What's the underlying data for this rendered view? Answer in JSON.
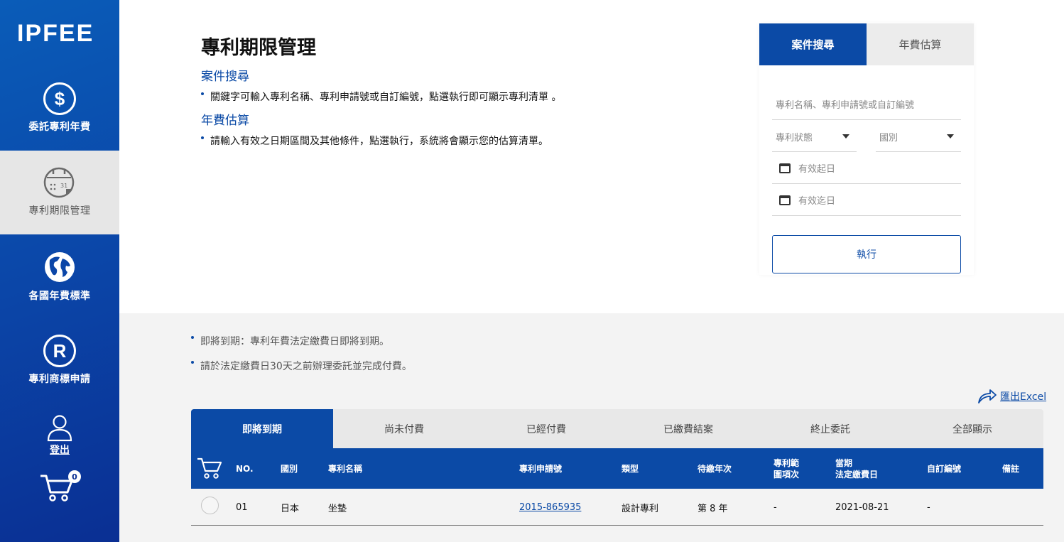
{
  "sidebar": {
    "logo": "IPFEE",
    "items": [
      {
        "label": "委託專利年費",
        "icon": "$"
      },
      {
        "label": "專利期限管理"
      },
      {
        "label": "各國年費標準"
      },
      {
        "label": "專利商標申請",
        "icon": "R"
      }
    ],
    "logout": "登出",
    "cart_count": "0"
  },
  "info": {
    "title": "專利期限管理",
    "sections": [
      {
        "heading": "案件搜尋",
        "bullet": "關鍵字可輸入專利名稱、專利申請號或自訂編號，點選執行即可顯示專利清單 。"
      },
      {
        "heading": "年費估算",
        "bullet": "請輸入有效之日期區間及其他條件，點選執行，系統將會顯示您的估算清單。"
      }
    ]
  },
  "search_panel": {
    "tabs": [
      "案件搜尋",
      "年費估算"
    ],
    "keyword_placeholder": "專利名稱、專利申請號或自訂編號",
    "status_select": "專利狀態",
    "country_select": "國別",
    "start_date": "有效起日",
    "end_date": "有效迄日",
    "execute": "執行"
  },
  "notes": [
    "即將到期：專利年費法定繳費日即將到期。",
    "請於法定繳費日30天之前辦理委託並完成付費。"
  ],
  "export": "匯出Excel",
  "tabs": [
    "即將到期",
    "尚未付費",
    "已經付費",
    "已繳費結案",
    "終止委託",
    "全部顯示"
  ],
  "table": {
    "headers": {
      "no": "NO.",
      "country": "國別",
      "name": "專利名稱",
      "app_no": "專利申請號",
      "type": "類型",
      "year": "待繳年次",
      "claims_1": "專利範",
      "claims_2": "圍項次",
      "due_1": "當期",
      "due_2": "法定繳費日",
      "custom": "自訂編號",
      "remark": "備註"
    },
    "rows": [
      {
        "no": "01",
        "country": "日本",
        "name": "坐墊",
        "app_no": "2015-865935",
        "type": "設計專利",
        "year": "第 8 年",
        "claims": "-",
        "due": "2021-08-21",
        "custom": "-",
        "remark": ""
      }
    ]
  },
  "colors": {
    "primary": "#0b4aa6",
    "grey_bg": "#f3f3f3"
  }
}
